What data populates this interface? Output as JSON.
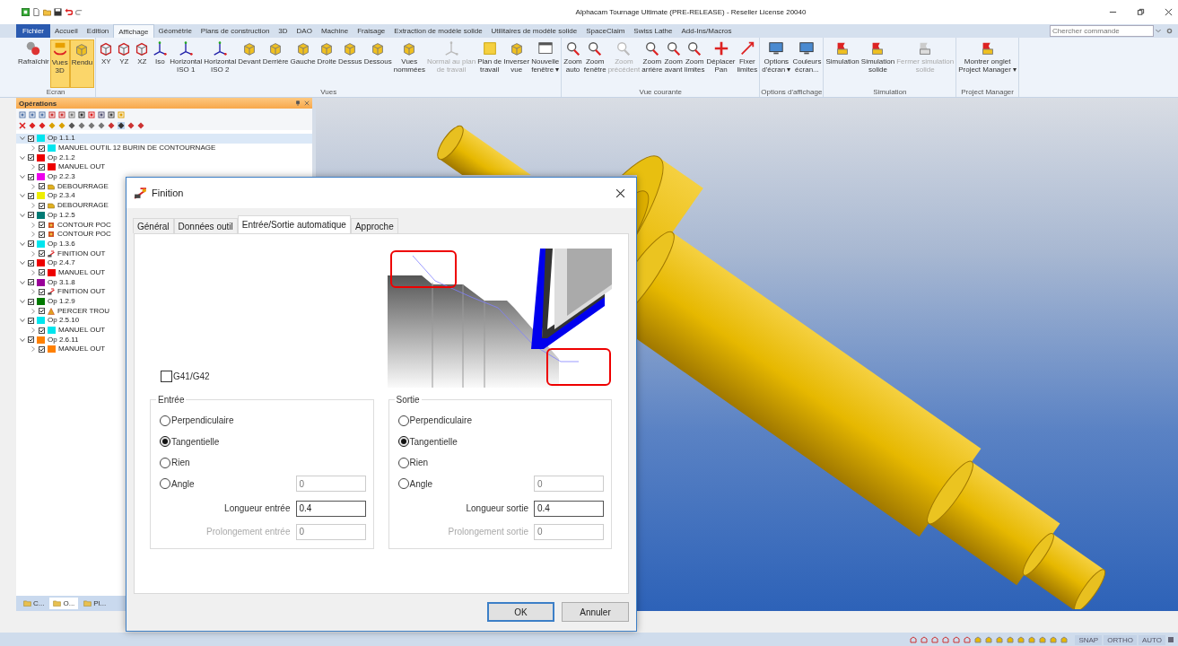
{
  "window": {
    "title": "Alphacam Tournage Ultimate (PRE-RELEASE) - Reseller License 20040"
  },
  "menu_tabs": [
    {
      "label": "Fichier",
      "kind": "file",
      "selected": false
    },
    {
      "label": "Accueil",
      "kind": "tab",
      "selected": false
    },
    {
      "label": "Edition",
      "kind": "tab",
      "selected": false
    },
    {
      "label": "Affichage",
      "kind": "tab",
      "selected": true
    },
    {
      "label": "Géométrie",
      "kind": "tab",
      "selected": false
    },
    {
      "label": "Plans de construction",
      "kind": "tab",
      "selected": false
    },
    {
      "label": "3D",
      "kind": "tab",
      "selected": false
    },
    {
      "label": "DAO",
      "kind": "tab",
      "selected": false
    },
    {
      "label": "Machine",
      "kind": "tab",
      "selected": false
    },
    {
      "label": "Fraisage",
      "kind": "tab",
      "selected": false
    },
    {
      "label": "Extraction de modèle solide",
      "kind": "tab",
      "selected": false
    },
    {
      "label": "Utilitaires de modèle solide",
      "kind": "tab",
      "selected": false
    },
    {
      "label": "SpaceClaim",
      "kind": "tab",
      "selected": false
    },
    {
      "label": "Swiss Lathe",
      "kind": "tab",
      "selected": false
    },
    {
      "label": "Add-Ins/Macros",
      "kind": "tab",
      "selected": false
    }
  ],
  "search": {
    "placeholder": "Chercher commande"
  },
  "ribbon_groups": [
    {
      "label": "Ecran",
      "buttons": [
        {
          "lines": [
            "Rafraîchir"
          ],
          "selected": false,
          "disabled": false
        },
        {
          "lines": [
            "Vues",
            "3D"
          ],
          "selected": true,
          "disabled": false
        },
        {
          "lines": [
            "Rendu"
          ],
          "selected": true,
          "disabled": false
        }
      ]
    },
    {
      "label": "Vues",
      "buttons": [
        {
          "lines": [
            "XY"
          ],
          "selected": false,
          "disabled": false
        },
        {
          "lines": [
            "YZ"
          ],
          "selected": false,
          "disabled": false
        },
        {
          "lines": [
            "XZ"
          ],
          "selected": false,
          "disabled": false
        },
        {
          "lines": [
            "Iso"
          ],
          "selected": false,
          "disabled": false
        },
        {
          "lines": [
            "Horizontal",
            "ISO 1"
          ],
          "selected": false,
          "disabled": false
        },
        {
          "lines": [
            "Horizontal",
            "ISO 2"
          ],
          "selected": false,
          "disabled": false
        },
        {
          "lines": [
            "Devant"
          ],
          "selected": false,
          "disabled": false
        },
        {
          "lines": [
            "Derrière"
          ],
          "selected": false,
          "disabled": false
        },
        {
          "lines": [
            "Gauche"
          ],
          "selected": false,
          "disabled": false
        },
        {
          "lines": [
            "Droite"
          ],
          "selected": false,
          "disabled": false
        },
        {
          "lines": [
            "Dessus"
          ],
          "selected": false,
          "disabled": false
        },
        {
          "lines": [
            "Dessous"
          ],
          "selected": false,
          "disabled": false
        },
        {
          "lines": [
            "Vues",
            "nommées"
          ],
          "selected": false,
          "disabled": false
        },
        {
          "lines": [
            "Normal au plan",
            "de travail"
          ],
          "selected": false,
          "disabled": true
        },
        {
          "lines": [
            "Plan de",
            "travail"
          ],
          "selected": false,
          "disabled": false
        },
        {
          "lines": [
            "Inverser",
            "vue"
          ],
          "selected": false,
          "disabled": false
        },
        {
          "lines": [
            "Nouvelle",
            "fenêtre ▾"
          ],
          "selected": false,
          "disabled": false
        }
      ]
    },
    {
      "label": "Vue courante",
      "buttons": [
        {
          "lines": [
            "Zoom",
            "auto"
          ],
          "selected": false,
          "disabled": false
        },
        {
          "lines": [
            "Zoom",
            "fenêtre"
          ],
          "selected": false,
          "disabled": false
        },
        {
          "lines": [
            "Zoom",
            "précédent"
          ],
          "selected": false,
          "disabled": true
        },
        {
          "lines": [
            "Zoom",
            "arrière"
          ],
          "selected": false,
          "disabled": false
        },
        {
          "lines": [
            "Zoom",
            "avant"
          ],
          "selected": false,
          "disabled": false
        },
        {
          "lines": [
            "Zoom",
            "limites"
          ],
          "selected": false,
          "disabled": false
        },
        {
          "lines": [
            "Déplacer",
            "Pan"
          ],
          "selected": false,
          "disabled": false
        },
        {
          "lines": [
            "Fixer",
            "limites"
          ],
          "selected": false,
          "disabled": false
        }
      ]
    },
    {
      "label": "Options d'affichage",
      "buttons": [
        {
          "lines": [
            "Options",
            "d'écran ▾"
          ],
          "selected": false,
          "disabled": false
        },
        {
          "lines": [
            "Couleurs",
            "écran..."
          ],
          "selected": false,
          "disabled": false
        }
      ]
    },
    {
      "label": "Simulation",
      "buttons": [
        {
          "lines": [
            "Simulation"
          ],
          "selected": false,
          "disabled": false
        },
        {
          "lines": [
            "Simulation",
            "solide"
          ],
          "selected": false,
          "disabled": false
        },
        {
          "lines": [
            "Fermer simulation",
            "solide"
          ],
          "selected": false,
          "disabled": true
        }
      ]
    },
    {
      "label": "Project Manager",
      "buttons": [
        {
          "lines": [
            "Montrer onglet",
            "Project Manager ▾"
          ],
          "selected": false,
          "disabled": false
        }
      ]
    }
  ],
  "operations_panel": {
    "title": "Opérations",
    "tree": [
      {
        "label": "Op 1.1.1",
        "color": "#00e5ee",
        "expanded": true,
        "selected": true,
        "children": [
          {
            "label": "MANUEL  OUTIL 12 BURIN DE CONTOURNAGE",
            "kind": "manual",
            "color": "#00e5ee"
          }
        ]
      },
      {
        "label": "Op 2.1.2",
        "color": "#ee0000",
        "expanded": true,
        "selected": false,
        "children": [
          {
            "label": "MANUEL  OUT",
            "kind": "manual",
            "color": "#ee0000"
          }
        ]
      },
      {
        "label": "Op 2.2.3",
        "color": "#ee00ee",
        "expanded": true,
        "selected": false,
        "children": [
          {
            "label": "DEBOURRAGE",
            "kind": "roughing"
          }
        ]
      },
      {
        "label": "Op 2.3.4",
        "color": "#eeee00",
        "expanded": true,
        "selected": false,
        "children": [
          {
            "label": "DEBOURRAGE",
            "kind": "roughing"
          }
        ]
      },
      {
        "label": "Op 1.2.5",
        "color": "#007a74",
        "expanded": true,
        "selected": false,
        "children": [
          {
            "label": "CONTOUR POC",
            "kind": "contour"
          },
          {
            "label": "CONTOUR POC",
            "kind": "contour"
          }
        ]
      },
      {
        "label": "Op 1.3.6",
        "color": "#00e5ee",
        "expanded": true,
        "selected": false,
        "children": [
          {
            "label": "FINITION  OUT",
            "kind": "finish"
          }
        ]
      },
      {
        "label": "Op 2.4.7",
        "color": "#ee0000",
        "expanded": true,
        "selected": false,
        "children": [
          {
            "label": "MANUEL  OUT",
            "kind": "manual",
            "color": "#ee0000"
          }
        ]
      },
      {
        "label": "Op 3.1.8",
        "color": "#990099",
        "expanded": true,
        "selected": false,
        "children": [
          {
            "label": "FINITION  OUT",
            "kind": "finish"
          }
        ]
      },
      {
        "label": "Op 1.2.9",
        "color": "#007a00",
        "expanded": true,
        "selected": false,
        "children": [
          {
            "label": "PERCER TROU",
            "kind": "drill"
          }
        ]
      },
      {
        "label": "Op 2.5.10",
        "color": "#00e5ee",
        "expanded": true,
        "selected": false,
        "children": [
          {
            "label": "MANUEL  OUT",
            "kind": "manual",
            "color": "#00e5ee"
          }
        ]
      },
      {
        "label": "Op 2.6.11",
        "color": "#ff8000",
        "expanded": true,
        "selected": false,
        "children": [
          {
            "label": "MANUEL  OUT",
            "kind": "manual",
            "color": "#ff8000"
          }
        ]
      }
    ],
    "bottom_tabs": [
      {
        "label": "C...",
        "selected": false
      },
      {
        "label": "O...",
        "selected": true
      },
      {
        "label": "Pl...",
        "selected": false
      }
    ]
  },
  "dialog": {
    "title": "Finition",
    "tabs": [
      {
        "label": "Général",
        "selected": false
      },
      {
        "label": "Données outil",
        "selected": false
      },
      {
        "label": "Entrée/Sortie automatique",
        "selected": true
      },
      {
        "label": "Approche",
        "selected": false
      }
    ],
    "g41_g42": {
      "label": "G41/G42",
      "checked": false
    },
    "groups": [
      {
        "title": "Entrée",
        "options": [
          {
            "label": "Perpendiculaire",
            "selected": false
          },
          {
            "label": "Tangentielle",
            "selected": true
          },
          {
            "label": "Rien",
            "selected": false
          },
          {
            "label": "Angle",
            "selected": false
          }
        ],
        "angle": {
          "value": "0",
          "disabled": true
        },
        "length": {
          "label": "Longueur entrée",
          "value": "0.4",
          "disabled": false
        },
        "extension": {
          "label": "Prolongement entrée",
          "value": "0",
          "disabled": true
        }
      },
      {
        "title": "Sortie",
        "options": [
          {
            "label": "Perpendiculaire",
            "selected": false
          },
          {
            "label": "Tangentielle",
            "selected": true
          },
          {
            "label": "Rien",
            "selected": false
          },
          {
            "label": "Angle",
            "selected": false
          }
        ],
        "angle": {
          "value": "0",
          "disabled": true
        },
        "length": {
          "label": "Longueur sortie",
          "value": "0.4",
          "disabled": false
        },
        "extension": {
          "label": "Prolongement sortie",
          "value": "0",
          "disabled": true
        }
      }
    ],
    "buttons": [
      {
        "label": "OK",
        "default": true
      },
      {
        "label": "Annuler",
        "default": false
      }
    ]
  },
  "status_bar": {
    "toggles": [
      {
        "label": "SNAP",
        "on": false
      },
      {
        "label": "ORTHO",
        "on": false
      },
      {
        "label": "AUTO",
        "on": false
      }
    ]
  }
}
